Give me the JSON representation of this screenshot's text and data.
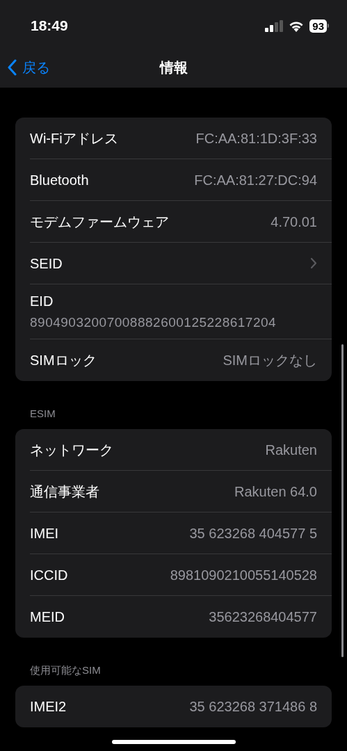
{
  "status_bar": {
    "time": "18:49",
    "battery": "93"
  },
  "nav": {
    "back": "戻る",
    "title": "情報"
  },
  "sections": [
    {
      "rows": [
        {
          "kind": "value",
          "label": "Wi-Fiアドレス",
          "value": "FC:AA:81:1D:3F:33"
        },
        {
          "kind": "value",
          "label": "Bluetooth",
          "value": "FC:AA:81:27:DC:94"
        },
        {
          "kind": "value",
          "label": "モデムファームウェア",
          "value": "4.70.01"
        },
        {
          "kind": "chevron",
          "label": "SEID"
        },
        {
          "kind": "stacked",
          "label": "EID",
          "value": "89049032007008882600125228617204"
        },
        {
          "kind": "value",
          "label": "SIMロック",
          "value": "SIMロックなし"
        }
      ]
    },
    {
      "header": "ESIM",
      "rows": [
        {
          "kind": "value",
          "label": "ネットワーク",
          "value": "Rakuten"
        },
        {
          "kind": "value",
          "label": "通信事業者",
          "value": "Rakuten 64.0"
        },
        {
          "kind": "value",
          "label": "IMEI",
          "value": "35 623268 404577 5"
        },
        {
          "kind": "value",
          "label": "ICCID",
          "value": "8981090210055140528"
        },
        {
          "kind": "value",
          "label": "MEID",
          "value": "35623268404577"
        }
      ]
    },
    {
      "header": "使用可能なSIM",
      "rows": [
        {
          "kind": "value",
          "label": "IMEI2",
          "value": "35 623268 371486 8"
        }
      ]
    }
  ]
}
